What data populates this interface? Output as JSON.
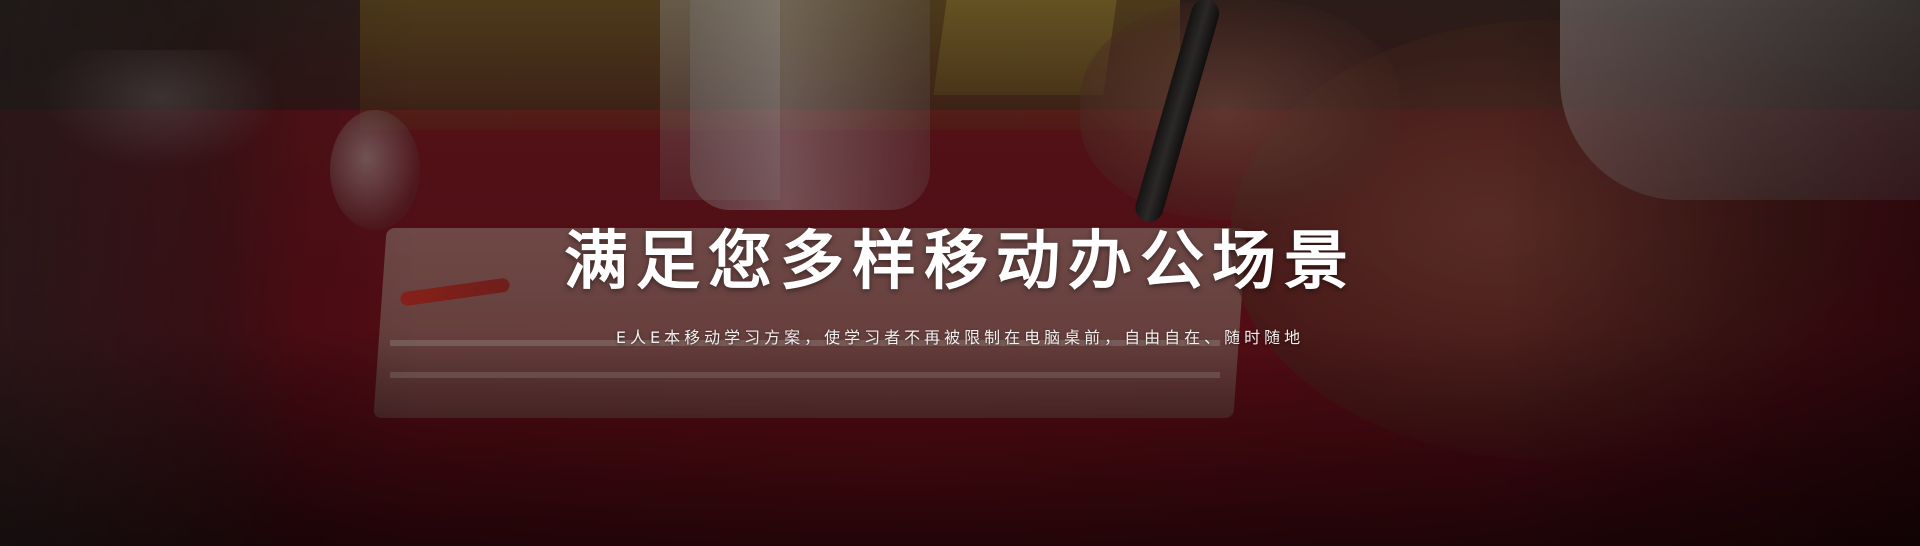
{
  "hero": {
    "headline": "满足您多样移动办公场景",
    "subtitle": "E人E本移动学习方案，使学习者不再被限制在电脑桌前，自由自在、随时随地"
  }
}
